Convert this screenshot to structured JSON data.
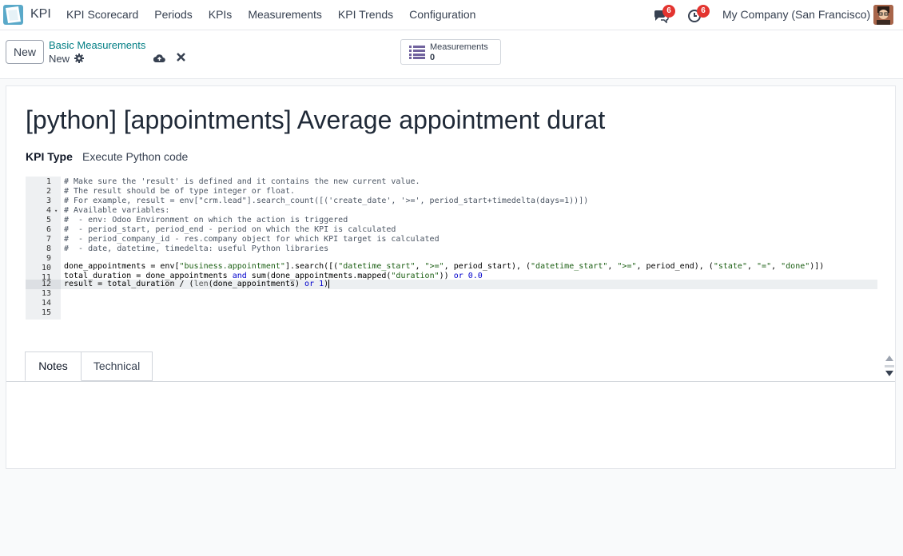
{
  "nav": {
    "app_name": "KPI",
    "menu": [
      "KPI Scorecard",
      "Periods",
      "KPIs",
      "Measurements",
      "KPI Trends",
      "Configuration"
    ],
    "messages_badge": "6",
    "activities_badge": "6",
    "company": "My Company (San Francisco)"
  },
  "control": {
    "new_label": "New",
    "breadcrumb": "Basic Measurements",
    "record_name": "New",
    "smart_button": {
      "label": "Measurements",
      "value": "0"
    }
  },
  "form": {
    "title": "[python] [appointments] Average appointment durat",
    "kpi_type_label": "KPI Type",
    "kpi_type_value": "Execute Python code"
  },
  "code": {
    "line_numbers": [
      "1",
      "2",
      "3",
      "4",
      "5",
      "6",
      "7",
      "8",
      "9",
      "10",
      "11",
      "12",
      "13",
      "14",
      "15"
    ],
    "comments": [
      "# Make sure the 'result' is defined and it contains the new current value.",
      "# The result should be of type integer or float.",
      "# For example, result = env[\"crm.lead\"].search_count([('create_date', '>=', period_start+timedelta(days=1))])",
      "# Available variables:",
      "#  - env: Odoo Environment on which the action is triggered",
      "#  - period_start, period_end - period on which the KPI is calculated",
      "#  - period_company_id - res.company object for which KPI target is calculated",
      "#  - date, datetime, timedelta: useful Python libraries"
    ],
    "line10": {
      "a": "done_appointments = env[",
      "b": "\"business.appointment\"",
      "c": "].search([(",
      "d": "\"datetime_start\"",
      "e": ", ",
      "f": "\">=\"",
      "g": ", period_start), (",
      "h": "\"datetime_start\"",
      "i": ", ",
      "j": "\">=\"",
      "k": ", period_end), (",
      "l": "\"state\"",
      "m": ", ",
      "n": "\"=\"",
      "o": ", ",
      "p": "\"done\"",
      "q": ")])"
    },
    "line11": {
      "a": "total_duration = done_appointments ",
      "b": "and",
      "c": " sum(done_appointments.mapped(",
      "d": "\"duration\"",
      "e": ")) ",
      "f": "or",
      "g": " ",
      "h": "0.0"
    },
    "line12": {
      "a": "result = total_duration / (",
      "b": "len",
      "c": "(done_appointments) ",
      "d": "or",
      "e": " ",
      "f": "1",
      "g": ")"
    }
  },
  "tabs": [
    "Notes",
    "Technical"
  ]
}
